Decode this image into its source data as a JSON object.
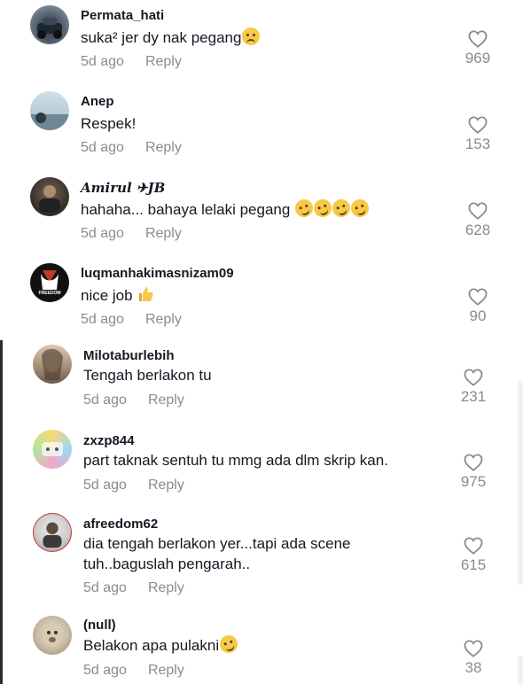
{
  "comments": [
    {
      "username": "Permata_hati",
      "text": "suka² jer dy nak pegang",
      "emoji": "😒",
      "time": "5d ago",
      "reply": "Reply",
      "likes": "969"
    },
    {
      "username": "Anep",
      "text": "Respek!",
      "time": "5d ago",
      "reply": "Reply",
      "likes": "153"
    },
    {
      "username": "𝑨𝒎𝒊𝒓𝒖𝒍 ✈JB",
      "text": "hahaha... bahaya lelaki pegang",
      "emoji": "🤣🤣🤣🤣",
      "time": "5d ago",
      "reply": "Reply",
      "likes": "628"
    },
    {
      "username": "luqmanhakimasnizam09",
      "text": "nice job",
      "emoji": "👍",
      "time": "5d ago",
      "reply": "Reply",
      "likes": "90"
    },
    {
      "username": "Milotaburlebih",
      "text": "Tengah berlakon tu",
      "time": "5d ago",
      "reply": "Reply",
      "likes": "231"
    },
    {
      "username": "zxzp844",
      "text": "part taknak sentuh tu mmg ada dlm skrip kan.",
      "time": "5d ago",
      "reply": "Reply",
      "likes": "975"
    },
    {
      "username": "afreedom62",
      "text": "dia tengah berlakon yer...tapi ada scene",
      "text2": "tuh..baguslah pengarah..",
      "time": "5d ago",
      "reply": "Reply",
      "likes": "615"
    },
    {
      "username": "(null)",
      "text": "Belakon apa pulakni",
      "emoji": "🤣",
      "time": "5d ago",
      "reply": "Reply",
      "likes": "38"
    }
  ],
  "avatar_badge_text": "FREEDOM",
  "colors": {
    "text": "#161823",
    "secondary": "#8a8b91",
    "heart": "#8a8b91",
    "emoji": "#f7c948"
  },
  "icons": {
    "like": "heart-outline-icon"
  }
}
